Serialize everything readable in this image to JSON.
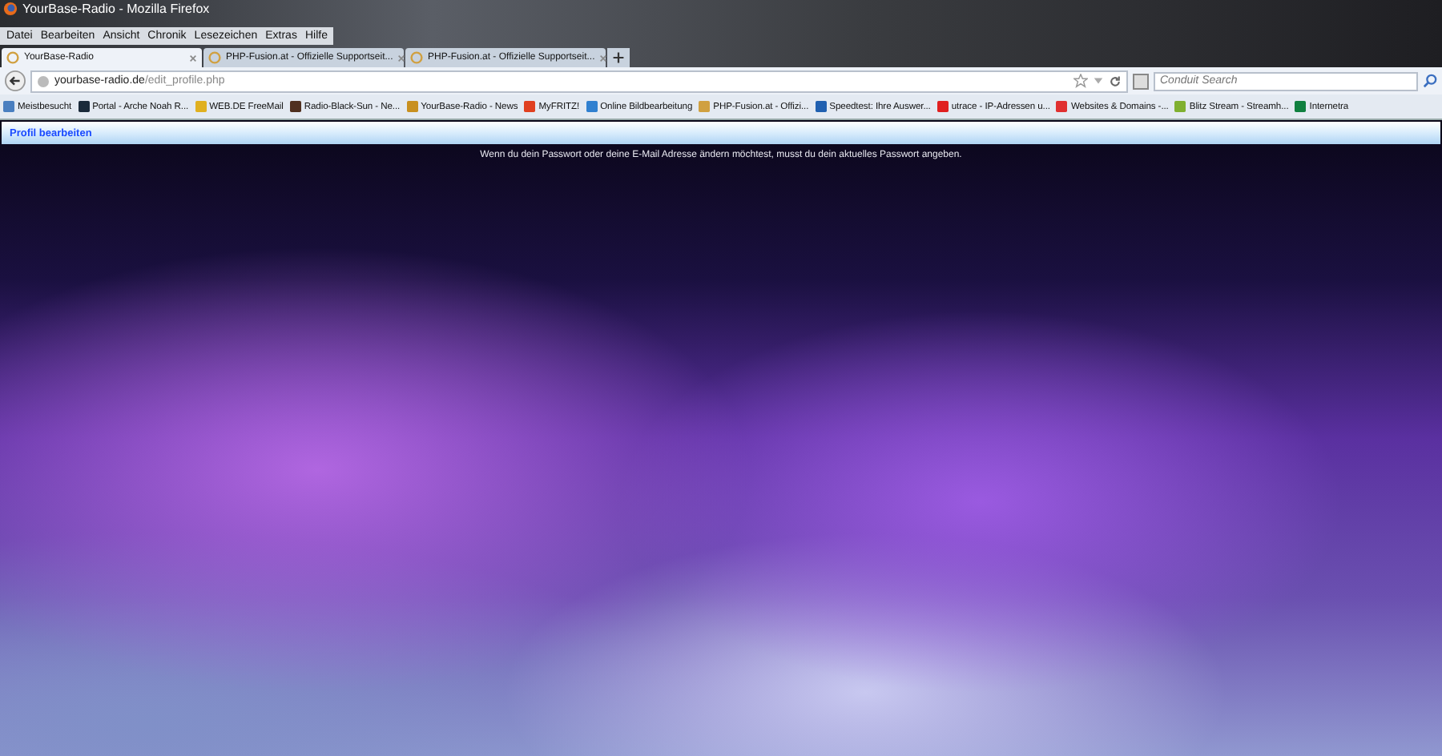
{
  "window": {
    "title": "YourBase-Radio - Mozilla Firefox"
  },
  "menu": [
    "Datei",
    "Bearbeiten",
    "Ansicht",
    "Chronik",
    "Lesezeichen",
    "Extras",
    "Hilfe"
  ],
  "tabs": [
    {
      "label": "YourBase-Radio",
      "selected": true
    },
    {
      "label": "PHP-Fusion.at - Offizielle Supportseit...",
      "selected": false
    },
    {
      "label": "PHP-Fusion.at - Offizielle Supportseit...",
      "selected": false
    }
  ],
  "address": {
    "host": "yourbase-radio.de",
    "path": "/edit_profile.php"
  },
  "search": {
    "placeholder": "Conduit Search"
  },
  "bookmarks": [
    {
      "label": "Meistbesucht",
      "color": "#4a7fc0"
    },
    {
      "label": "Portal - Arche Noah R...",
      "color": "#1a2a3a"
    },
    {
      "label": "WEB.DE FreeMail",
      "color": "#e0b020"
    },
    {
      "label": "Radio-Black-Sun - Ne...",
      "color": "#503020"
    },
    {
      "label": "YourBase-Radio - News",
      "color": "#c89020"
    },
    {
      "label": "MyFRITZ!",
      "color": "#e04020"
    },
    {
      "label": "Online Bildbearbeitung",
      "color": "#3080d0"
    },
    {
      "label": "PHP-Fusion.at - Offizi...",
      "color": "#d0a040"
    },
    {
      "label": "Speedtest: Ihre Auswer...",
      "color": "#2060b0"
    },
    {
      "label": "utrace - IP-Adressen u...",
      "color": "#e02020"
    },
    {
      "label": "Websites & Domains -...",
      "color": "#e03030"
    },
    {
      "label": "Blitz Stream - Streamh...",
      "color": "#80b030"
    },
    {
      "label": "Internetra",
      "color": "#108040"
    }
  ],
  "page": {
    "header": "Profil bearbeiten",
    "message": "Wenn du dein Passwort oder deine E-Mail Adresse ändern möchtest, musst du dein aktuelles Passwort angeben."
  }
}
